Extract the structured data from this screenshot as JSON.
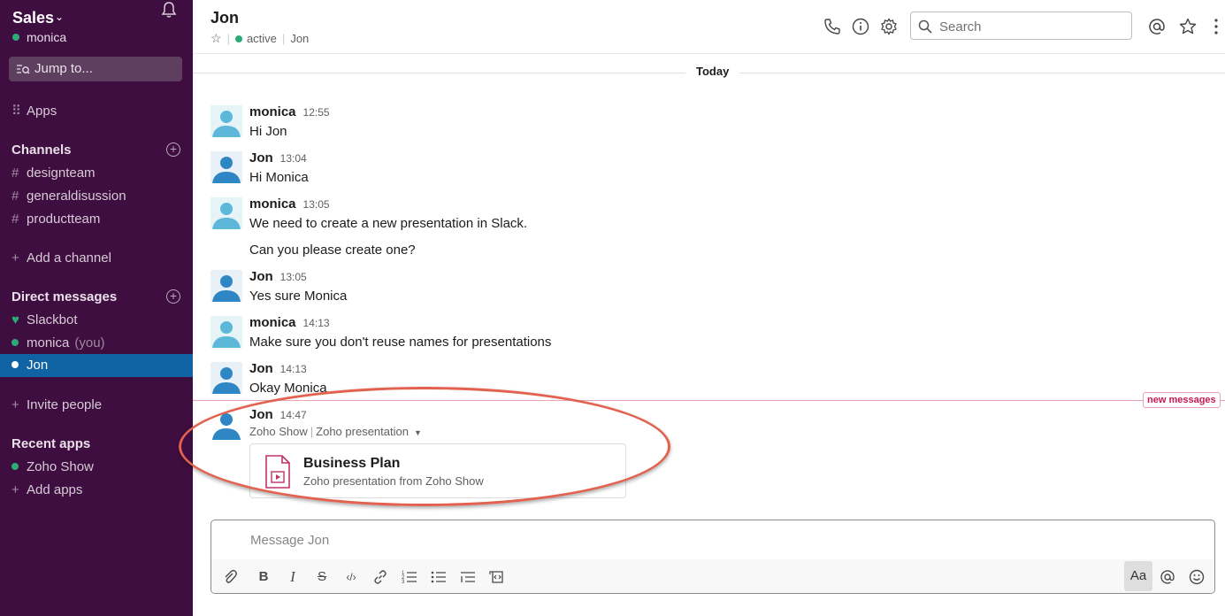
{
  "workspace": {
    "name": "Sales",
    "user": "monica"
  },
  "sidebar": {
    "jump_label": "Jump to...",
    "apps_label": "Apps",
    "channels_header": "Channels",
    "channels": [
      "designteam",
      "generaldisussion",
      "productteam"
    ],
    "add_channel": "Add a channel",
    "dm_header": "Direct messages",
    "dms": [
      {
        "name": "Slackbot"
      },
      {
        "name": "monica",
        "suffix": "(you)"
      },
      {
        "name": "Jon"
      }
    ],
    "invite": "Invite people",
    "recent_apps_header": "Recent apps",
    "recent_apps": [
      "Zoho Show"
    ],
    "add_apps": "Add apps"
  },
  "header": {
    "title": "Jon",
    "status": "active",
    "subtitle_name": "Jon",
    "search_placeholder": "Search"
  },
  "day_divider": "Today",
  "messages": [
    {
      "author": "monica",
      "time": "12:55",
      "lines": [
        "Hi Jon"
      ]
    },
    {
      "author": "Jon",
      "time": "13:04",
      "lines": [
        "Hi Monica"
      ]
    },
    {
      "author": "monica",
      "time": "13:05",
      "lines": [
        "We need to create a new presentation in Slack.",
        "Can you please create one?"
      ]
    },
    {
      "author": "Jon",
      "time": "13:05",
      "lines": [
        "Yes sure Monica"
      ]
    },
    {
      "author": "monica",
      "time": "14:13",
      "lines": [
        "Make sure you don't reuse names for presentations"
      ]
    },
    {
      "author": "Jon",
      "time": "14:13",
      "lines": [
        "Okay Monica"
      ]
    },
    {
      "author": "Jon",
      "time": "14:47",
      "app": "Zoho Show",
      "app_context": "Zoho presentation",
      "attachment": {
        "title": "Business Plan",
        "description": "Zoho presentation from Zoho Show"
      }
    }
  ],
  "new_messages_label": "new messages",
  "composer": {
    "placeholder": "Message Jon",
    "format_label": "Aa"
  },
  "colors": {
    "sidebar": "#3f0e40",
    "active": "#1164a3",
    "presence": "#2bac76",
    "new_messages": "#c41a51",
    "annotation_oval": "#e2614f"
  }
}
